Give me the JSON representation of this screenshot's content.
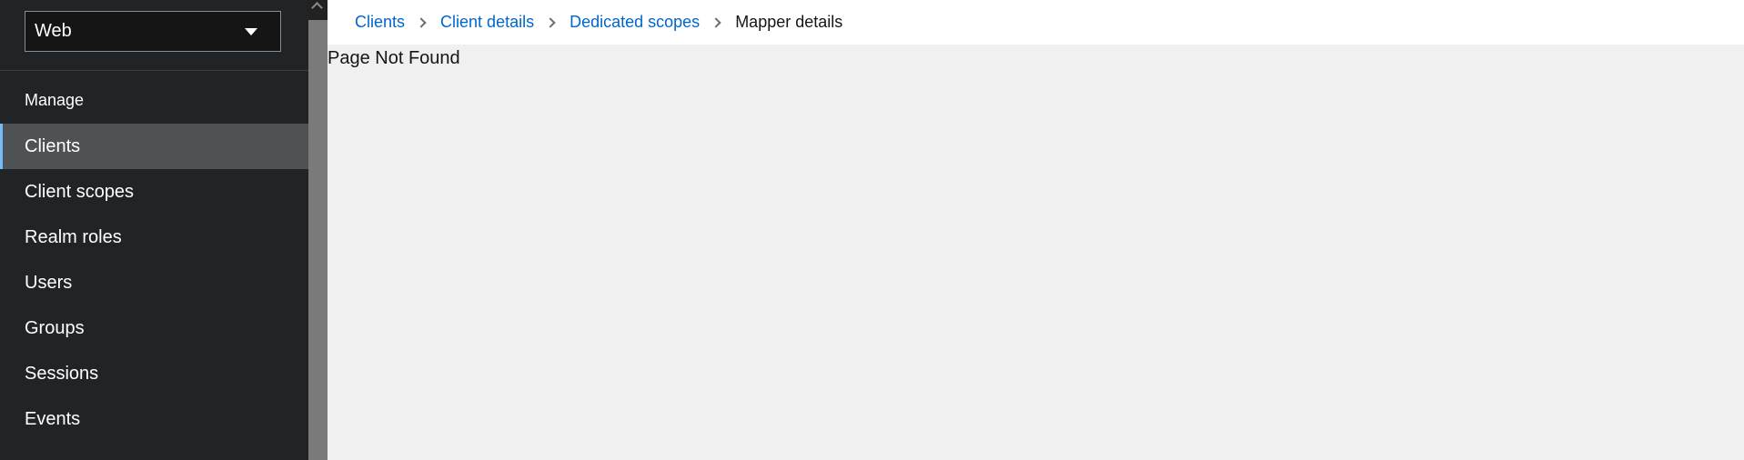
{
  "realm_selector": {
    "value": "Web"
  },
  "sidebar": {
    "section_title": "Manage",
    "items": [
      {
        "label": "Clients",
        "active": true
      },
      {
        "label": "Client scopes"
      },
      {
        "label": "Realm roles"
      },
      {
        "label": "Users"
      },
      {
        "label": "Groups"
      },
      {
        "label": "Sessions"
      },
      {
        "label": "Events"
      }
    ]
  },
  "breadcrumb": {
    "items": [
      "Clients",
      "Client details",
      "Dedicated scopes",
      "Mapper details"
    ]
  },
  "main": {
    "message": "Page Not Found"
  },
  "colors": {
    "sidebar_bg": "#212427",
    "active_item_bg": "#4f5255",
    "active_indicator": "#73bcf7",
    "link": "#0066cc",
    "page_bg": "#f0f0f0"
  },
  "icons": {
    "realm_caret": "caret-down-icon",
    "breadcrumb_separator": "chevron-right-icon",
    "scroll_up": "chevron-up-icon"
  }
}
